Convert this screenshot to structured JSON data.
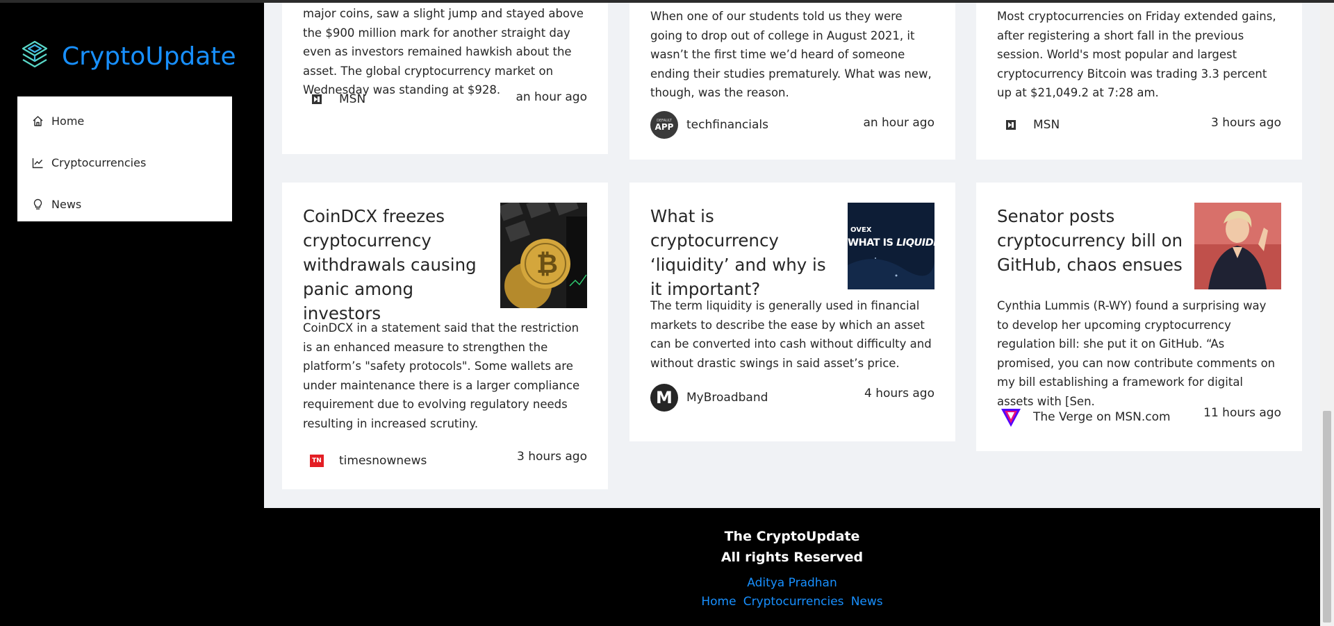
{
  "brand": {
    "title": "CryptoUpdate",
    "accent": "#1890ff"
  },
  "menu": [
    {
      "label": "Home",
      "icon": "home-icon"
    },
    {
      "label": "Cryptocurrencies",
      "icon": "line-chart-icon"
    },
    {
      "label": "News",
      "icon": "bulb-icon"
    }
  ],
  "top_cards": [
    {
      "body": "major coins, saw a slight jump and stayed above the $900 million mark for another straight day even as investors remained hawkish about the asset. The global cryptocurrency market on Wednesday was standing at $928.",
      "provider": "MSN",
      "time": "an hour ago"
    },
    {
      "body": "When one of our students told us they were going to drop out of college in August 2021, it wasn’t the first time we’d heard of someone ending their studies prematurely. What was new, though, was the reason.",
      "provider": "techfinancials",
      "time": "an hour ago",
      "logo_text": [
        "DEFAULT",
        "APP"
      ]
    },
    {
      "body": "Most cryptocurrencies on Friday extended gains, after registering a short fall in the previous session. World's most popular and largest cryptocurrency Bitcoin was trading 3.3 percent up at $21,049.2 at 7:28 am.",
      "provider": "MSN",
      "time": "3 hours ago"
    }
  ],
  "cards": [
    {
      "title": "CoinDCX freezes cryptocurrency withdrawals causing panic among investors",
      "body": "CoinDCX in a statement said that the restriction is an enhanced measure to strengthen the platform’s \"safety protocols\". Some wallets are under maintenance there is a larger compliance requirement due to evolving regulatory needs resulting in increased scrutiny.",
      "provider": "timesnownews",
      "time": "3 hours ago",
      "logo_text": "TN"
    },
    {
      "title": "What is cryptocurrency ‘liquidity’ and why is it important?",
      "body": "The term liquidity is generally used in financial markets to describe the ease by which an asset can be converted into cash without difficulty and without drastic swings in said asset’s price.",
      "provider": "MyBroadband",
      "time": "4 hours ago",
      "logo_text": "M",
      "thumb_text": [
        "OVEX",
        "WHAT IS ",
        "LIQUIDIT"
      ]
    },
    {
      "title": "Senator posts cryptocurrency bill on GitHub, chaos ensues",
      "body": "Cynthia Lummis (R-WY) found a surprising way to develop her upcoming cryptocurrency regulation bill: she put it on GitHub. “As promised, you can now contribute comments on my bill establishing a framework for digital assets with [Sen.",
      "provider": "The Verge on MSN.com",
      "time": "11 hours ago"
    }
  ],
  "footer": {
    "line1": "The CryptoUpdate",
    "line2": "All rights Reserved",
    "author": "Aditya Pradhan",
    "links": [
      "Home",
      "Cryptocurrencies",
      "News"
    ]
  }
}
